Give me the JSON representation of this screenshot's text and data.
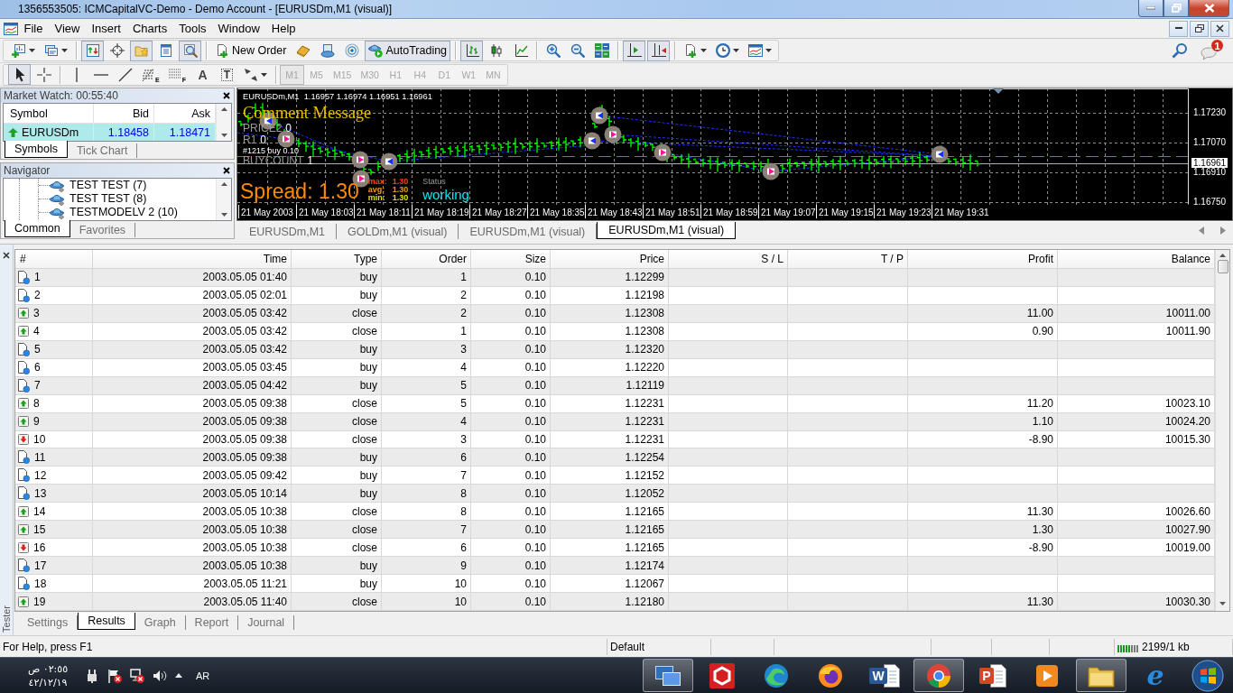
{
  "window": {
    "title": "1356553505: ICMCapitalVC-Demo - Demo Account - [EURUSDm,M1 (visual)]"
  },
  "menu": [
    "File",
    "View",
    "Insert",
    "Charts",
    "Tools",
    "Window",
    "Help"
  ],
  "toolbar": [
    [
      {
        "pressed": false
      },
      {
        "pressed": false
      }
    ],
    [
      {
        "pressed": true
      },
      {
        "pressed": false
      },
      {
        "pressed": true
      },
      {
        "pressed": false
      },
      {
        "pressed": true
      }
    ],
    [
      {
        "label": "New Order",
        "pressed": false
      },
      {
        "pressed": false
      },
      {
        "pressed": false
      },
      {
        "pressed": false
      },
      {
        "label": "AutoTrading",
        "pressed": true
      }
    ],
    [
      {
        "pressed": true
      },
      {
        "pressed": false
      },
      {
        "pressed": false
      }
    ],
    [
      {
        "pressed": false
      },
      {
        "pressed": false
      },
      {
        "pressed": false
      }
    ],
    [
      {
        "pressed": true
      },
      {
        "pressed": true
      }
    ],
    [
      {
        "pressed": false
      },
      {
        "pressed": false
      },
      {
        "pressed": false
      }
    ]
  ],
  "notifications": {
    "count": "1"
  },
  "drawing_tools": [
    [
      {
        "pressed": true
      },
      {
        "pressed": false
      }
    ],
    [
      {
        "pressed": false
      },
      {
        "pressed": false
      },
      {
        "pressed": false
      },
      {
        "pressed": false,
        "glyph": "E"
      },
      {
        "pressed": false,
        "glyph": "F"
      },
      {
        "pressed": false,
        "glyph": "A"
      },
      {
        "pressed": false,
        "glyph": "T"
      },
      {
        "pressed": false
      }
    ]
  ],
  "timeframes": [
    {
      "label": "M1",
      "selected": true,
      "disabled": true
    },
    {
      "label": "M5",
      "selected": false,
      "disabled": true
    },
    {
      "label": "M15",
      "selected": false,
      "disabled": true
    },
    {
      "label": "M30",
      "selected": false,
      "disabled": true
    },
    {
      "label": "H1",
      "selected": false,
      "disabled": true
    },
    {
      "label": "H4",
      "selected": false,
      "disabled": true
    },
    {
      "label": "D1",
      "selected": false,
      "disabled": true
    },
    {
      "label": "W1",
      "selected": false,
      "disabled": true
    },
    {
      "label": "MN",
      "selected": false,
      "disabled": true
    }
  ],
  "market_watch": {
    "title": "Market Watch: 00:55:40",
    "columns": [
      "Symbol",
      "Bid",
      "Ask"
    ],
    "rows": [
      {
        "symbol": "EURUSDm",
        "bid": "1.18458",
        "ask": "1.18471",
        "rising": true,
        "selected": true
      }
    ],
    "tabs": [
      {
        "label": "Symbols",
        "selected": true
      },
      {
        "label": "Tick Chart",
        "selected": false
      }
    ]
  },
  "navigator": {
    "title": "Navigator",
    "items": [
      "TEST TEST (7)",
      "TEST TEST (8)",
      "TESTMODELV 2 (10)"
    ],
    "tabs": [
      {
        "label": "Common",
        "selected": true
      },
      {
        "label": "Favorites",
        "selected": false
      }
    ]
  },
  "chart": {
    "info": "EURUSDm,M1  1.16957 1.16974 1.16951 1.16961",
    "comment": "Comment Message",
    "indicators": [
      {
        "label": "PRICE2",
        "value": "0"
      },
      {
        "label": "R1",
        "value": "0"
      }
    ],
    "order": "#1215 buy 0.10",
    "buy_count": {
      "label": "BUYCOUNT",
      "value": "1"
    },
    "spread": "Spread: 1.30",
    "spread_stats": [
      {
        "label": "max:",
        "value": "1.30",
        "color": "#ff4010"
      },
      {
        "label": "avg:",
        "value": "1.30",
        "color": "#e8a000"
      },
      {
        "label": "min:",
        "value": "1.30",
        "color": "#e0e000"
      }
    ],
    "status": {
      "label": "Status",
      "value": "working"
    },
    "price_labels": [
      "1.17230",
      "1.17070",
      "1.16910",
      "1.16750"
    ],
    "current_price": "1.16961",
    "time_labels": [
      "21 May 2003",
      "21 May 18:03",
      "21 May 18:11",
      "21 May 18:19",
      "21 May 18:27",
      "21 May 18:35",
      "21 May 18:43",
      "21 May 18:51",
      "21 May 18:59",
      "21 May 19:07",
      "21 May 19:15",
      "21 May 19:23",
      "21 May 19:31"
    ]
  },
  "chart_tabs": [
    {
      "label": "EURUSDm,M1",
      "selected": false
    },
    {
      "label": "GOLDm,M1 (visual)",
      "selected": false
    },
    {
      "label": "EURUSDm,M1 (visual)",
      "selected": false
    },
    {
      "label": "EURUSDm,M1 (visual)",
      "selected": true
    }
  ],
  "tester": {
    "title": "Tester",
    "columns": [
      "#",
      "Time",
      "Type",
      "Order",
      "Size",
      "Price",
      "S / L",
      "T / P",
      "Profit",
      "Balance"
    ],
    "rows": [
      {
        "kind": "open",
        "num": "1",
        "time": "2003.05.05 01:40",
        "type": "buy",
        "order": "1",
        "size": "0.10",
        "price": "1.12299"
      },
      {
        "kind": "open",
        "num": "2",
        "time": "2003.05.05 02:01",
        "type": "buy",
        "order": "2",
        "size": "0.10",
        "price": "1.12198"
      },
      {
        "kind": "profit",
        "num": "3",
        "time": "2003.05.05 03:42",
        "type": "close",
        "order": "2",
        "size": "0.10",
        "price": "1.12308",
        "profit": "11.00",
        "balance": "10011.00"
      },
      {
        "kind": "profit",
        "num": "4",
        "time": "2003.05.05 03:42",
        "type": "close",
        "order": "1",
        "size": "0.10",
        "price": "1.12308",
        "profit": "0.90",
        "balance": "10011.90"
      },
      {
        "kind": "open",
        "num": "5",
        "time": "2003.05.05 03:42",
        "type": "buy",
        "order": "3",
        "size": "0.10",
        "price": "1.12320"
      },
      {
        "kind": "open",
        "num": "6",
        "time": "2003.05.05 03:45",
        "type": "buy",
        "order": "4",
        "size": "0.10",
        "price": "1.12220"
      },
      {
        "kind": "open",
        "num": "7",
        "time": "2003.05.05 04:42",
        "type": "buy",
        "order": "5",
        "size": "0.10",
        "price": "1.12119"
      },
      {
        "kind": "profit",
        "num": "8",
        "time": "2003.05.05 09:38",
        "type": "close",
        "order": "5",
        "size": "0.10",
        "price": "1.12231",
        "profit": "11.20",
        "balance": "10023.10"
      },
      {
        "kind": "profit",
        "num": "9",
        "time": "2003.05.05 09:38",
        "type": "close",
        "order": "4",
        "size": "0.10",
        "price": "1.12231",
        "profit": "1.10",
        "balance": "10024.20"
      },
      {
        "kind": "loss",
        "num": "10",
        "time": "2003.05.05 09:38",
        "type": "close",
        "order": "3",
        "size": "0.10",
        "price": "1.12231",
        "profit": "-8.90",
        "balance": "10015.30"
      },
      {
        "kind": "open",
        "num": "11",
        "time": "2003.05.05 09:38",
        "type": "buy",
        "order": "6",
        "size": "0.10",
        "price": "1.12254"
      },
      {
        "kind": "open",
        "num": "12",
        "time": "2003.05.05 09:42",
        "type": "buy",
        "order": "7",
        "size": "0.10",
        "price": "1.12152"
      },
      {
        "kind": "open",
        "num": "13",
        "time": "2003.05.05 10:14",
        "type": "buy",
        "order": "8",
        "size": "0.10",
        "price": "1.12052"
      },
      {
        "kind": "profit",
        "num": "14",
        "time": "2003.05.05 10:38",
        "type": "close",
        "order": "8",
        "size": "0.10",
        "price": "1.12165",
        "profit": "11.30",
        "balance": "10026.60"
      },
      {
        "kind": "profit",
        "num": "15",
        "time": "2003.05.05 10:38",
        "type": "close",
        "order": "7",
        "size": "0.10",
        "price": "1.12165",
        "profit": "1.30",
        "balance": "10027.90"
      },
      {
        "kind": "loss",
        "num": "16",
        "time": "2003.05.05 10:38",
        "type": "close",
        "order": "6",
        "size": "0.10",
        "price": "1.12165",
        "profit": "-8.90",
        "balance": "10019.00"
      },
      {
        "kind": "open",
        "num": "17",
        "time": "2003.05.05 10:38",
        "type": "buy",
        "order": "9",
        "size": "0.10",
        "price": "1.12174"
      },
      {
        "kind": "open",
        "num": "18",
        "time": "2003.05.05 11:21",
        "type": "buy",
        "order": "10",
        "size": "0.10",
        "price": "1.12067"
      },
      {
        "kind": "profit",
        "num": "19",
        "time": "2003.05.05 11:40",
        "type": "close",
        "order": "10",
        "size": "0.10",
        "price": "1.12180",
        "profit": "11.30",
        "balance": "10030.30"
      }
    ],
    "tabs": [
      {
        "label": "Settings",
        "selected": false
      },
      {
        "label": "Results",
        "selected": true
      },
      {
        "label": "Graph",
        "selected": false
      },
      {
        "label": "Report",
        "selected": false
      },
      {
        "label": "Journal",
        "selected": false
      }
    ]
  },
  "status_bar": {
    "help": "For Help, press F1",
    "profile": "Default",
    "traffic": "2199/1 kb"
  },
  "taskbar": {
    "time": "٠٢:٥٥ ص",
    "date": "٤٢/١٢/١٩",
    "language": "AR",
    "apps": [
      {
        "kind": "windows",
        "active": true
      },
      {
        "kind": "hexagon",
        "active": false
      },
      {
        "kind": "edge",
        "active": false
      },
      {
        "kind": "firefox",
        "active": false
      },
      {
        "kind": "word",
        "glyph": "W",
        "active": false
      },
      {
        "kind": "chrome",
        "active": true
      },
      {
        "kind": "powerpoint",
        "glyph": "P",
        "active": false
      },
      {
        "kind": "media",
        "active": false
      },
      {
        "kind": "explorer",
        "active": true
      },
      {
        "kind": "ie",
        "glyph": "e",
        "active": false
      }
    ]
  }
}
